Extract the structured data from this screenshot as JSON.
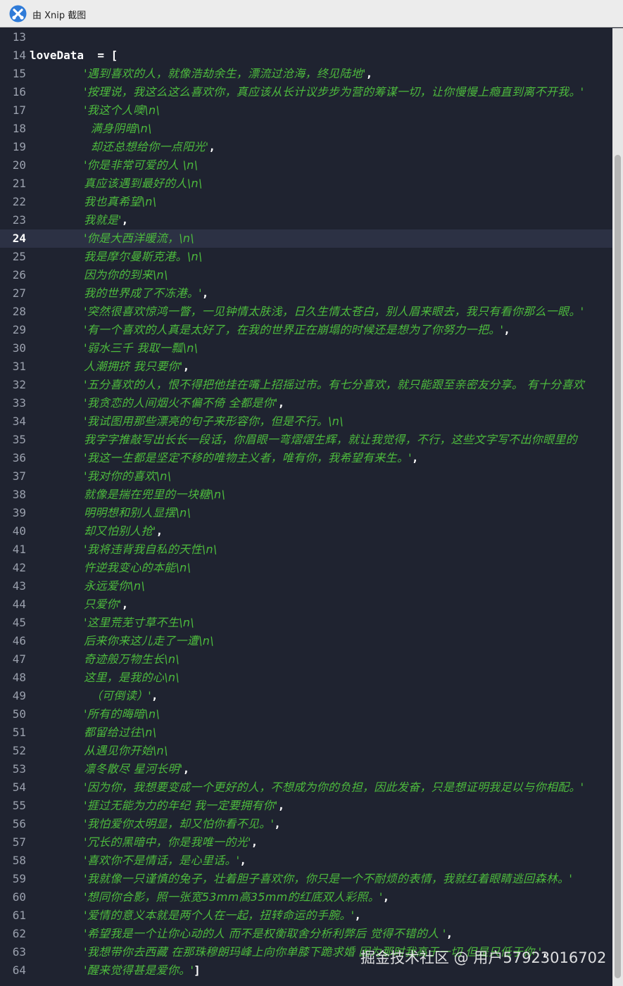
{
  "window": {
    "title": "由 Xnip 截图",
    "app_icon": "xnip-logo-icon"
  },
  "editor": {
    "current_line": 24,
    "colors": {
      "background": "#1f2330",
      "string": "#4dbb3d",
      "identifier": "#ffffff",
      "current_line_bg": "#2c3144"
    },
    "lines": [
      {
        "n": "13",
        "indent": "",
        "text": "",
        "tail": ""
      },
      {
        "n": "14",
        "indent": "",
        "ident": "loveData  = [",
        "text": "",
        "tail": ""
      },
      {
        "n": "15",
        "indent": "        ",
        "text": "'遇到喜欢的人，就像浩劫余生，漂流过沧海，终见陆地'",
        "tail": ","
      },
      {
        "n": "16",
        "indent": "        ",
        "text": "'按理说，我这么这么喜欢你，真应该从长计议步步为营的筹谋一切，让你慢慢上瘾直到离不开我。'",
        "tail": ""
      },
      {
        "n": "17",
        "indent": "        ",
        "text": "'我这个人噢\\n\\",
        "tail": ""
      },
      {
        "n": "18",
        "indent": "         ",
        "text": "满身阴暗\\n\\",
        "tail": ""
      },
      {
        "n": "19",
        "indent": "         ",
        "text": "却还总想给你一点阳光'",
        "tail": ","
      },
      {
        "n": "20",
        "indent": "        ",
        "text": "'你是非常可爱的人 \\n\\",
        "tail": ""
      },
      {
        "n": "21",
        "indent": "        ",
        "text": "真应该遇到最好的人\\n\\",
        "tail": ""
      },
      {
        "n": "22",
        "indent": "        ",
        "text": "我也真希望\\n\\",
        "tail": ""
      },
      {
        "n": "23",
        "indent": "        ",
        "text": "我就是'",
        "tail": ","
      },
      {
        "n": "24",
        "indent": "        ",
        "text": "'你是大西洋暖流，\\n\\",
        "tail": ""
      },
      {
        "n": "25",
        "indent": "        ",
        "text": "我是摩尔曼斯克港。\\n\\",
        "tail": ""
      },
      {
        "n": "26",
        "indent": "        ",
        "text": "因为你的到来\\n\\",
        "tail": ""
      },
      {
        "n": "27",
        "indent": "        ",
        "text": "我的世界成了不冻港。'",
        "tail": ","
      },
      {
        "n": "28",
        "indent": "        ",
        "text": "'突然很喜欢惊鸿一瞥，一见钟情太肤浅，日久生情太苍白，别人眉来眼去，我只有看你那么一眼。'",
        "tail": ""
      },
      {
        "n": "29",
        "indent": "        ",
        "text": "'有一个喜欢的人真是太好了，在我的世界正在崩塌的时候还是想为了你努力一把。'",
        "tail": ","
      },
      {
        "n": "30",
        "indent": "        ",
        "text": "'弱水三千 我取一瓢\\n\\",
        "tail": ""
      },
      {
        "n": "31",
        "indent": "        ",
        "text": "人潮拥挤 我只要你'",
        "tail": ","
      },
      {
        "n": "32",
        "indent": "        ",
        "text": "'五分喜欢的人，恨不得把他挂在嘴上招摇过市。有七分喜欢，就只能跟至亲密友分享。 有十分喜欢",
        "tail": ""
      },
      {
        "n": "33",
        "indent": "        ",
        "text": "'我贪恋的人间烟火不偏不倚 全都是你'",
        "tail": ","
      },
      {
        "n": "34",
        "indent": "        ",
        "text": "'我试图用那些漂亮的句子来形容你，但是不行。\\n\\",
        "tail": ""
      },
      {
        "n": "35",
        "indent": "        ",
        "text": "我字字推敲写出长长一段话，你眉眼一弯熠熠生辉，就让我觉得，不行，这些文字写不出你眼里的",
        "tail": ""
      },
      {
        "n": "36",
        "indent": "        ",
        "text": "'我这一生都是坚定不移的唯物主义者，唯有你，我希望有来生。'",
        "tail": ","
      },
      {
        "n": "37",
        "indent": "        ",
        "text": "'我对你的喜欢\\n\\",
        "tail": ""
      },
      {
        "n": "38",
        "indent": "        ",
        "text": "就像是揣在兜里的一块糖\\n\\",
        "tail": ""
      },
      {
        "n": "39",
        "indent": "        ",
        "text": "明明想和别人显摆\\n\\",
        "tail": ""
      },
      {
        "n": "40",
        "indent": "        ",
        "text": "却又怕别人抢'",
        "tail": ","
      },
      {
        "n": "41",
        "indent": "        ",
        "text": "'我将违背我自私的天性\\n\\",
        "tail": ""
      },
      {
        "n": "42",
        "indent": "        ",
        "text": "忤逆我变心的本能\\n\\",
        "tail": ""
      },
      {
        "n": "43",
        "indent": "        ",
        "text": "永远爱你\\n\\",
        "tail": ""
      },
      {
        "n": "44",
        "indent": "        ",
        "text": "只爱你'",
        "tail": ","
      },
      {
        "n": "45",
        "indent": "        ",
        "text": "'这里荒芜寸草不生\\n\\",
        "tail": ""
      },
      {
        "n": "46",
        "indent": "        ",
        "text": "后来你来这儿走了一遭\\n\\",
        "tail": ""
      },
      {
        "n": "47",
        "indent": "        ",
        "text": "奇迹般万物生长\\n\\",
        "tail": ""
      },
      {
        "n": "48",
        "indent": "        ",
        "text": "这里，是我的心\\n\\",
        "tail": ""
      },
      {
        "n": "49",
        "indent": "         ",
        "text": "（可倒读）'",
        "tail": ","
      },
      {
        "n": "50",
        "indent": "        ",
        "text": "'所有的晦暗\\n\\",
        "tail": ""
      },
      {
        "n": "51",
        "indent": "        ",
        "text": "都留给过往\\n\\",
        "tail": ""
      },
      {
        "n": "52",
        "indent": "        ",
        "text": "从遇见你开始\\n\\",
        "tail": ""
      },
      {
        "n": "53",
        "indent": "        ",
        "text": "凛冬散尽 星河长明'",
        "tail": ","
      },
      {
        "n": "54",
        "indent": "        ",
        "text": "'因为你，我想要变成一个更好的人，不想成为你的负担，因此发奋，只是想证明我足以与你相配。'",
        "tail": ""
      },
      {
        "n": "55",
        "indent": "        ",
        "text": "'捱过无能为力的年纪 我一定要拥有你'",
        "tail": ","
      },
      {
        "n": "56",
        "indent": "        ",
        "text": "'我怕爱你太明显，却又怕你看不见。'",
        "tail": ","
      },
      {
        "n": "57",
        "indent": "        ",
        "text": "'冗长的黑暗中，你是我唯一的光'",
        "tail": ","
      },
      {
        "n": "58",
        "indent": "        ",
        "text": "'喜欢你不是情话，是心里话。'",
        "tail": ","
      },
      {
        "n": "59",
        "indent": "        ",
        "text": "'我就像一只谨慎的兔子，壮着胆子喜欢你，你只是一个不耐烦的表情，我就红着眼睛逃回森林。'",
        "tail": ""
      },
      {
        "n": "60",
        "indent": "        ",
        "text": "'想同你合影，照一张宽53mm高35mm的红底双人彩照。'",
        "tail": ","
      },
      {
        "n": "61",
        "indent": "        ",
        "text": "'爱情的意义本就是两个人在一起，扭转命运的手腕。'",
        "tail": ","
      },
      {
        "n": "62",
        "indent": "        ",
        "text": "'希望我是一个让你心动的人 而不是权衡取舍分析利弊后 觉得不错的人 '",
        "tail": ","
      },
      {
        "n": "63",
        "indent": "        ",
        "text": "'我想带你去西藏 在那珠穆朗玛峰上向你单膝下跪求婚 因为那时我高于一切 但是只低于你 '",
        "tail": ","
      },
      {
        "n": "64",
        "indent": "        ",
        "text": "'醒来觉得甚是爱你。'",
        "tail": "]"
      }
    ]
  },
  "watermark": "掘金技术社区 @ 用户57923016702"
}
